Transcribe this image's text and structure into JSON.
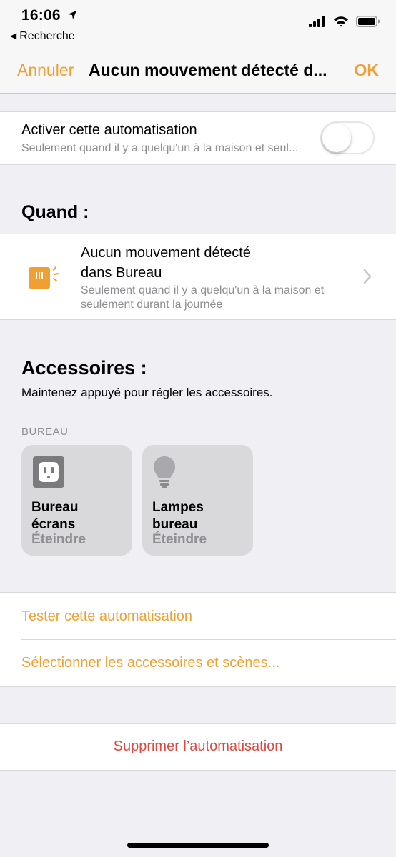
{
  "status_bar": {
    "time": "16:06",
    "back_app_label": "Recherche",
    "icons": [
      "location-arrow-icon",
      "signal-icon",
      "wifi-icon",
      "battery-icon"
    ]
  },
  "navbar": {
    "cancel_label": "Annuler",
    "title": "Aucun mouvement détecté d...",
    "ok_label": "OK"
  },
  "enable": {
    "title": "Activer cette automatisation",
    "subtitle": "Seulement quand il y a quelqu'un à la maison et seul...",
    "toggle_on": false
  },
  "when": {
    "heading": "Quand :",
    "trigger": {
      "icon": "motion-sensor-icon",
      "title_line1": "Aucun mouvement détecté",
      "title_line2": "dans Bureau",
      "subtitle": "Seulement quand il y a quelqu'un à la maison et seulement durant la journée"
    }
  },
  "accessories": {
    "heading": "Accessoires :",
    "hint": "Maintenez appuyé pour régler les accessoires.",
    "section_label": "BUREAU",
    "tiles": [
      {
        "icon": "outlet-icon",
        "name_line1": "Bureau",
        "name_line2": "écrans",
        "state": "Éteindre"
      },
      {
        "icon": "lightbulb-icon",
        "name_line1": "Lampes",
        "name_line2": "bureau",
        "state": "Éteindre"
      }
    ]
  },
  "actions": {
    "test_label": "Tester cette automatisation",
    "select_label": "Sélectionner les accessoires et scènes..."
  },
  "delete_label": "Supprimer l’automatisation",
  "colors": {
    "accent": "#f0a030",
    "destructive": "#e0483e",
    "secondary_text": "#8e8e93",
    "background": "#efeff4"
  }
}
